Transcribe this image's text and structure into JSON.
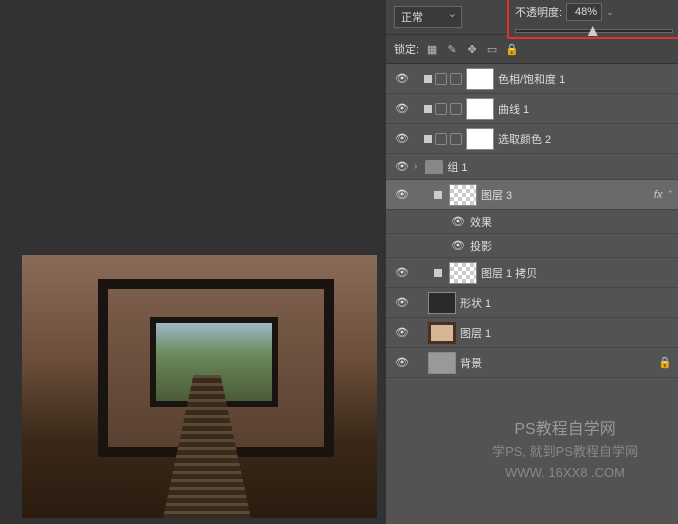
{
  "toolbar": {
    "blend_mode": "正常",
    "opacity_label": "不透明度:",
    "opacity_value": "48%",
    "lock_label": "锁定:"
  },
  "layers": {
    "adj1": "色相/饱和度 1",
    "adj2": "曲线 1",
    "adj3": "选取颜色 2",
    "group1": "组 1",
    "layer3": "图层 3",
    "effects": "效果",
    "shadow": "投影",
    "layer1copy": "图层 1 拷贝",
    "shape1": "形状 1",
    "layer1": "图层 1",
    "background": "背景"
  },
  "fx": "fx",
  "watermark": {
    "title": "PS教程自学网",
    "sub1": "学PS, 就到PS教程自学网",
    "sub2": "WWW. 16XX8 .COM"
  }
}
